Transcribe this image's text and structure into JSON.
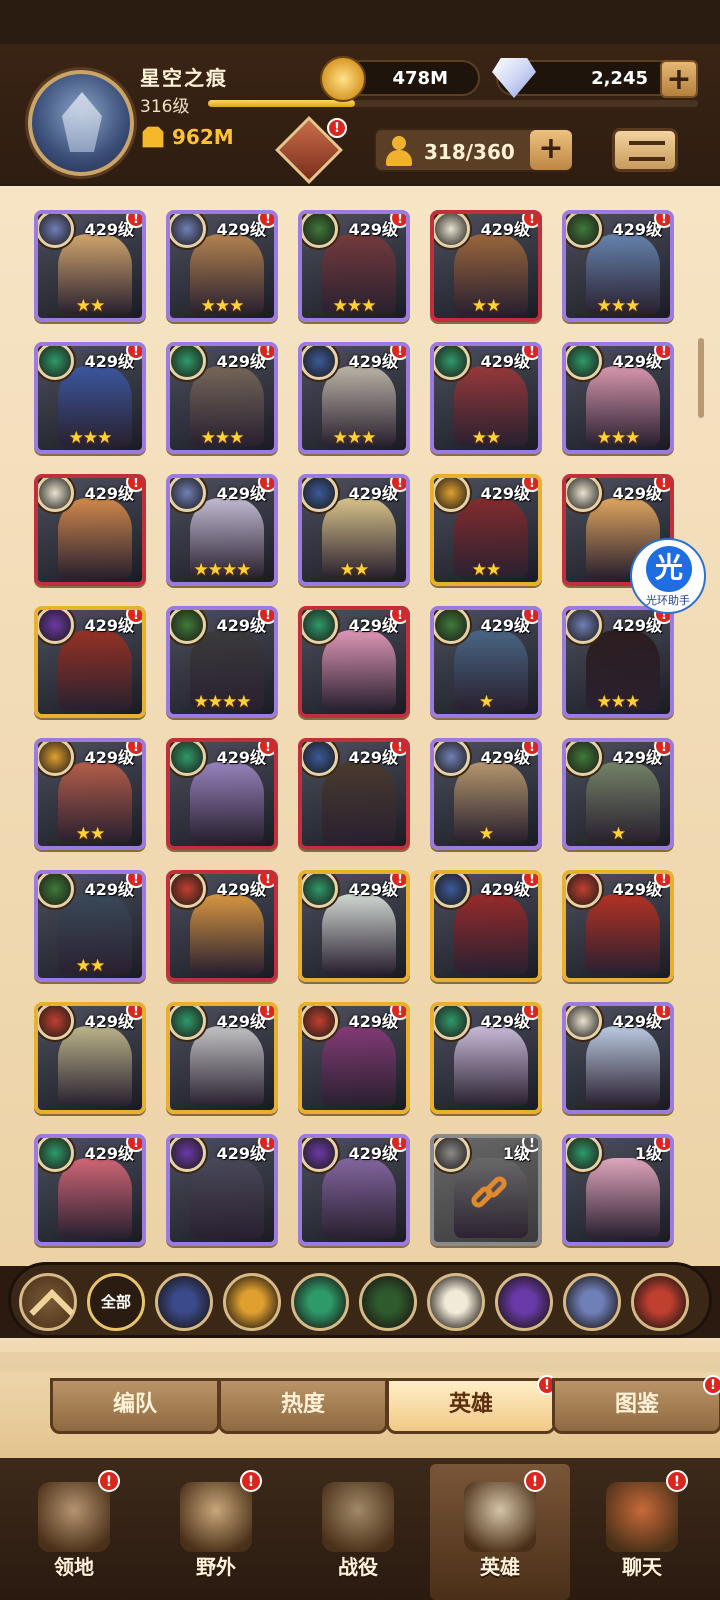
{
  "player": {
    "name": "星空之痕",
    "level": "316级",
    "xp_progress": 0.3,
    "power": "962M"
  },
  "currency": {
    "gold": "478M",
    "gems": "2,245",
    "plus": "+"
  },
  "roster": {
    "count": "318/360",
    "plus": "+"
  },
  "heroes": [
    {
      "level": "429级",
      "stars": "★★",
      "frame": "purple",
      "faction_color": "#6f7fb8",
      "portrait": "#e0b070"
    },
    {
      "level": "429级",
      "stars": "★★★",
      "frame": "purple",
      "faction_color": "#6f7fb8",
      "portrait": "#c08a50"
    },
    {
      "level": "429级",
      "stars": "★★★",
      "frame": "purple",
      "faction_color": "#3e7a3a",
      "portrait": "#7a3a3a"
    },
    {
      "level": "429级",
      "stars": "★★",
      "frame": "red",
      "faction_color": "#e8e2d0",
      "portrait": "#a46a3a"
    },
    {
      "level": "429级",
      "stars": "★★★",
      "frame": "purple",
      "faction_color": "#3e7a3a",
      "portrait": "#6a8ab8"
    },
    {
      "level": "429级",
      "stars": "★★★",
      "frame": "purple",
      "faction_color": "#2e9a6a",
      "portrait": "#3a5aa8"
    },
    {
      "level": "429级",
      "stars": "★★★",
      "frame": "purple",
      "faction_color": "#2e9a6a",
      "portrait": "#7a6a5a"
    },
    {
      "level": "429级",
      "stars": "★★★",
      "frame": "purple",
      "faction_color": "#3a5a9a",
      "portrait": "#c8c0b0"
    },
    {
      "level": "429级",
      "stars": "★★",
      "frame": "purple",
      "faction_color": "#2e9a6a",
      "portrait": "#a03838"
    },
    {
      "level": "429级",
      "stars": "★★★",
      "frame": "purple",
      "faction_color": "#2e9a6a",
      "portrait": "#e8a0b8"
    },
    {
      "level": "429级",
      "stars": "",
      "frame": "red",
      "faction_color": "#e8e2d0",
      "portrait": "#e0904a"
    },
    {
      "level": "429级",
      "stars": "★★★★",
      "frame": "purple",
      "faction_color": "#6f7fb8",
      "portrait": "#d0c8e0"
    },
    {
      "level": "429级",
      "stars": "★★",
      "frame": "purple",
      "faction_color": "#3a5a9a",
      "portrait": "#e8d090"
    },
    {
      "level": "429级",
      "stars": "★★",
      "frame": "gold",
      "faction_color": "#e0a030",
      "portrait": "#8a2a2a"
    },
    {
      "level": "429级",
      "stars": "",
      "frame": "red",
      "faction_color": "#e8e2d0",
      "portrait": "#f0b060"
    },
    {
      "level": "429级",
      "stars": "",
      "frame": "gold",
      "faction_color": "#6a3aa8",
      "portrait": "#a03020"
    },
    {
      "level": "429级",
      "stars": "★★★★",
      "frame": "purple",
      "faction_color": "#3e7a3a",
      "portrait": "#3a3a3a"
    },
    {
      "level": "429级",
      "stars": "",
      "frame": "red",
      "faction_color": "#2e9a6a",
      "portrait": "#f0a0c0"
    },
    {
      "level": "429级",
      "stars": "★",
      "frame": "purple",
      "faction_color": "#3e7a3a",
      "portrait": "#4a6a8a"
    },
    {
      "level": "429级",
      "stars": "★★★",
      "frame": "purple",
      "faction_color": "#6f7fb8",
      "portrait": "#2a1a1a"
    },
    {
      "level": "429级",
      "stars": "★★",
      "frame": "purple",
      "faction_color": "#e0a030",
      "portrait": "#c0604a"
    },
    {
      "level": "429级",
      "stars": "",
      "frame": "red",
      "faction_color": "#2e9a6a",
      "portrait": "#a08ac8"
    },
    {
      "level": "429级",
      "stars": "",
      "frame": "red",
      "faction_color": "#3a5a9a",
      "portrait": "#4a3a2a"
    },
    {
      "level": "429级",
      "stars": "★",
      "frame": "purple",
      "faction_color": "#6f7fb8",
      "portrait": "#c0a070"
    },
    {
      "level": "429级",
      "stars": "★",
      "frame": "purple",
      "faction_color": "#3e7a3a",
      "portrait": "#7a8a6a"
    },
    {
      "level": "429级",
      "stars": "★★",
      "frame": "purple",
      "faction_color": "#3e7a3a",
      "portrait": "#3a4a5a"
    },
    {
      "level": "429级",
      "stars": "",
      "frame": "red",
      "faction_color": "#c04030",
      "portrait": "#e8a040"
    },
    {
      "level": "429级",
      "stars": "",
      "frame": "gold",
      "faction_color": "#2e9a6a",
      "portrait": "#e0e8e0"
    },
    {
      "level": "429级",
      "stars": "",
      "frame": "gold",
      "faction_color": "#3a5a9a",
      "portrait": "#a02828"
    },
    {
      "level": "429级",
      "stars": "",
      "frame": "gold",
      "faction_color": "#c04030",
      "portrait": "#c03020"
    },
    {
      "level": "429级",
      "stars": "",
      "frame": "gold",
      "faction_color": "#c04030",
      "portrait": "#c8c090"
    },
    {
      "level": "429级",
      "stars": "",
      "frame": "gold",
      "faction_color": "#2e9a6a",
      "portrait": "#d0d0d0"
    },
    {
      "level": "429级",
      "stars": "",
      "frame": "gold",
      "faction_color": "#c04030",
      "portrait": "#8a3a7a"
    },
    {
      "level": "429级",
      "stars": "",
      "frame": "gold",
      "faction_color": "#2e9a6a",
      "portrait": "#d8c8e8"
    },
    {
      "level": "429级",
      "stars": "",
      "frame": "purple",
      "faction_color": "#e8e2d0",
      "portrait": "#c8d8f0"
    },
    {
      "level": "429级",
      "stars": "",
      "frame": "purple",
      "faction_color": "#2e9a6a",
      "portrait": "#e06a7a"
    },
    {
      "level": "429级",
      "stars": "",
      "frame": "purple",
      "faction_color": "#6a3aa8",
      "portrait": "#4a4a5a"
    },
    {
      "level": "429级",
      "stars": "",
      "frame": "purple",
      "faction_color": "#6a3aa8",
      "portrait": "#8a6aa8"
    },
    {
      "level": "1级",
      "stars": "",
      "frame": "gray",
      "faction_color": "#8a8a8a",
      "portrait": "#6a6a6a",
      "locked": true
    },
    {
      "level": "1级",
      "stars": "",
      "frame": "purple",
      "faction_color": "#2e9a6a",
      "portrait": "#f0b0c8"
    }
  ],
  "factions": [
    "全部"
  ],
  "faction_icons": [
    "up-arrow-icon",
    "all",
    "lightbearer-icon",
    "mauler-icon",
    "wilder-icon",
    "graveborn-icon",
    "celestial-icon",
    "hypogean-icon",
    "dimensional-icon",
    "flame-icon"
  ],
  "faction_colors": [
    "",
    "",
    "#3a4a8a",
    "#e0a030",
    "#2e9a6a",
    "#2e5a2e",
    "#f0ead8",
    "#6a3aa8",
    "#6f7fb8",
    "#c04030"
  ],
  "subtabs": [
    "编队",
    "热度",
    "英雄",
    "图鉴"
  ],
  "nav": [
    "领地",
    "野外",
    "战役",
    "英雄",
    "聊天"
  ],
  "helper": {
    "glyph": "光",
    "label": "光环助手"
  },
  "badge": "!"
}
